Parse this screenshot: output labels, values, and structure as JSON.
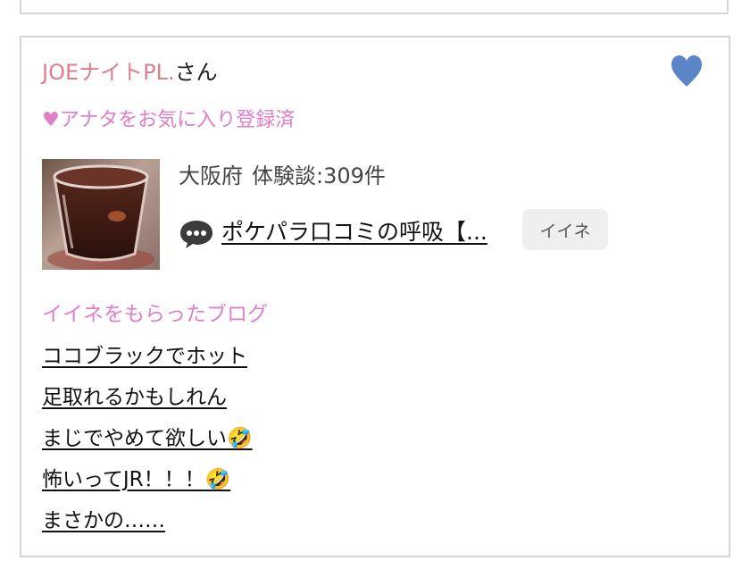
{
  "card": {
    "user_name": "JOEナイトPL.",
    "user_suffix": "さん",
    "favorite_status": "♥アナタをお気に入り登録済",
    "location": "大阪府",
    "experience_count": "体験談:309件",
    "latest_post_title": "ポケパラ口コミの呼吸【...",
    "like_button_label": "イイネ",
    "heart_color": "#5a86c9"
  },
  "liked_blogs": {
    "heading": "イイネをもらったブログ",
    "items": [
      {
        "title": "ココブラックでホット"
      },
      {
        "title": "足取れるかもしれん"
      },
      {
        "title": "まじでやめて欲しい🤣"
      },
      {
        "title": "怖いってJR！！！🤣"
      },
      {
        "title": "まさかの……"
      }
    ]
  },
  "colors": {
    "name_pink": "#dd7e8c",
    "accent_pink": "#e07ec8",
    "border": "#d6d6d6"
  },
  "icons": {
    "favorite": "heart-icon",
    "comment": "speech-bubble-icon"
  }
}
